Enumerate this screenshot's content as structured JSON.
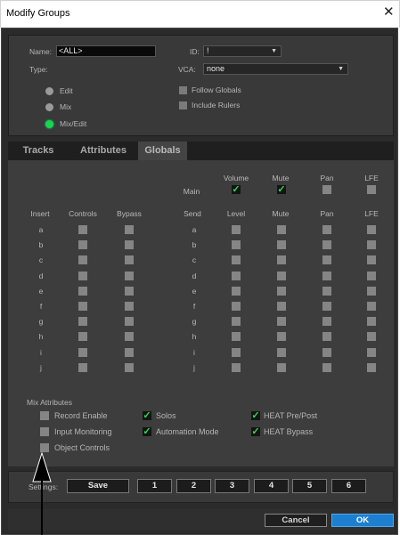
{
  "window": {
    "title": "Modify Groups",
    "close_glyph": "✕"
  },
  "header": {
    "name_label": "Name:",
    "name_value": "<ALL>",
    "id_label": "ID:",
    "id_value": "!",
    "vca_label": "VCA:",
    "vca_value": "none",
    "type_label": "Type:",
    "types": [
      {
        "label": "Edit",
        "selected": false
      },
      {
        "label": "Mix",
        "selected": false
      },
      {
        "label": "Mix/Edit",
        "selected": true
      }
    ],
    "follow_globals": "Follow Globals",
    "include_rulers": "Include Rulers"
  },
  "tabs": [
    {
      "label": "Tracks",
      "active": false
    },
    {
      "label": "Attributes",
      "active": false
    },
    {
      "label": "Globals",
      "active": true
    }
  ],
  "globals": {
    "main_label": "Main",
    "main_columns": [
      "Volume",
      "Mute",
      "Pan",
      "LFE"
    ],
    "main_checked": [
      true,
      true,
      false,
      false
    ],
    "insert_headers": [
      "Insert",
      "Controls",
      "Bypass"
    ],
    "send_headers": [
      "Send",
      "Level",
      "Mute",
      "Pan",
      "LFE"
    ],
    "rows": [
      "a",
      "b",
      "c",
      "d",
      "e",
      "f",
      "g",
      "h",
      "i",
      "j"
    ],
    "mix_attributes_title": "Mix Attributes",
    "mix_attributes": [
      {
        "label": "Record Enable",
        "checked": false
      },
      {
        "label": "Input Monitoring",
        "checked": false
      },
      {
        "label": "Object Controls",
        "checked": false
      },
      {
        "label": "Solos",
        "checked": true
      },
      {
        "label": "Automation Mode",
        "checked": true
      },
      {
        "label": "HEAT Pre/Post",
        "checked": true
      },
      {
        "label": "HEAT Bypass",
        "checked": true
      }
    ]
  },
  "settings": {
    "label": "Settings:",
    "save_label": "Save",
    "slots": [
      "1",
      "2",
      "3",
      "4",
      "5",
      "6"
    ]
  },
  "footer": {
    "cancel_label": "Cancel",
    "ok_label": "OK"
  },
  "colors": {
    "accent": "#1e7fd0",
    "check_green": "#22e04a",
    "radio_on": "#18d64a",
    "panel": "#3d3d3d"
  },
  "icons": {
    "close": "close-icon",
    "dropdown": "chevron-down-icon",
    "check": "checkmark-icon",
    "pointer": "arrow-pointer-icon"
  }
}
